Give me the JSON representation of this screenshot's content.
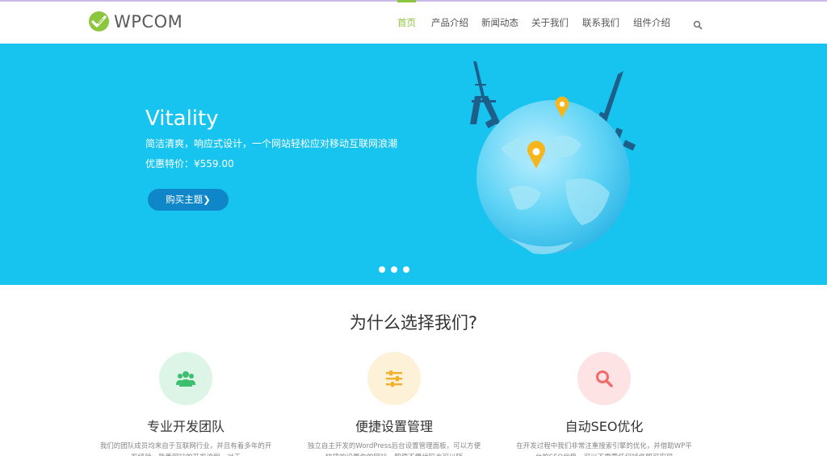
{
  "header": {
    "logo_text": "WPCOM",
    "nav": [
      {
        "label": "首页",
        "active": true
      },
      {
        "label": "产品介绍",
        "active": false
      },
      {
        "label": "新闻动态",
        "active": false
      },
      {
        "label": "关于我们",
        "active": false
      },
      {
        "label": "联系我们",
        "active": false
      },
      {
        "label": "组件介绍",
        "active": false
      }
    ],
    "search_icon": "search-icon"
  },
  "hero": {
    "title": "Vitality",
    "subtitle": "简洁清爽，响应式设计，一个网站轻松应对移动互联网浪潮",
    "price": "优惠特价：¥559.00",
    "button_label": "购买主题",
    "button_icon": "chevron-right-icon",
    "slide_count": 3,
    "bg_color": "#17c4ef"
  },
  "why": {
    "title": "为什么选择我们?",
    "features": [
      {
        "icon": "users-icon",
        "title": "专业开发团队",
        "desc": "我们的团队成员均来自于互联网行业，并且有着多年的开发经验，熟悉网站的开发流程，对于",
        "circle_color": "#ddf5e6",
        "icon_color": "#3bbf6e"
      },
      {
        "icon": "sliders-icon",
        "title": "便捷设置管理",
        "desc": "独立自主开发的WordPress后台设置管理面板，可以方便快捷的设置你的网站，即便不懂代码也可以随",
        "circle_color": "#fdf1d8",
        "icon_color": "#f2b12d"
      },
      {
        "icon": "search-icon",
        "title": "自动SEO优化",
        "desc": "在开发过程中我们非常注重搜索引擎的优化，并借助WP平台的SEO优势，可以不需要任何插件即可实现",
        "circle_color": "#fde3e3",
        "icon_color": "#f06a6a"
      }
    ]
  },
  "colors": {
    "brand_green": "#8cc63e",
    "button_blue": "#0e86c8"
  }
}
